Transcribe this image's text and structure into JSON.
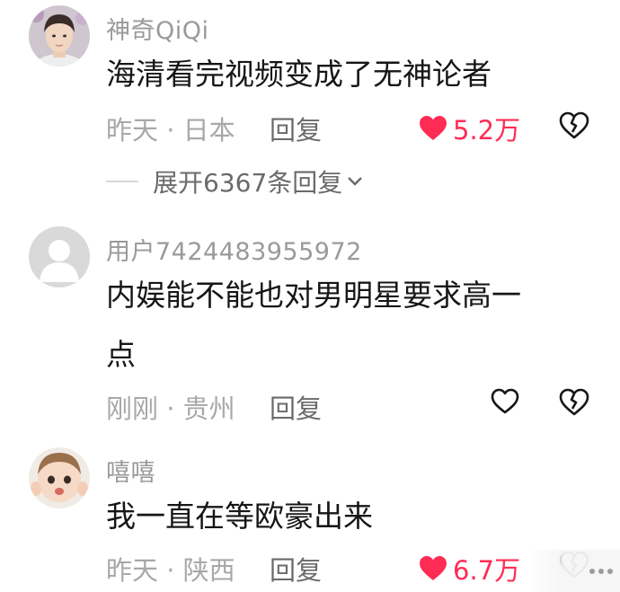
{
  "comments": [
    {
      "username": "神奇QiQi",
      "text": "海清看完视频变成了无神论者",
      "meta": "昨天 · 日本",
      "reply_label": "回复",
      "likes": "5.2万",
      "liked": true,
      "expand_label": "展开6367条回复"
    },
    {
      "username": "用户7424483955972",
      "text_line1": "内娱能不能也对男明星要求高一",
      "text_line2": "点",
      "meta": "刚刚 · 贵州",
      "reply_label": "回复",
      "liked": false
    },
    {
      "username": "嘻嘻",
      "text": "我一直在等欧豪出来",
      "meta": "昨天 · 陕西",
      "reply_label": "回复",
      "likes": "6.7万",
      "liked": true
    }
  ],
  "colors": {
    "like_red": "#fe2c55",
    "username_gray": "#9a9a9a",
    "text_black": "#161616"
  },
  "icons": [
    "heart-filled-icon",
    "heart-outline-icon",
    "broken-heart-icon",
    "chevron-down-icon",
    "more-dots-icon"
  ]
}
